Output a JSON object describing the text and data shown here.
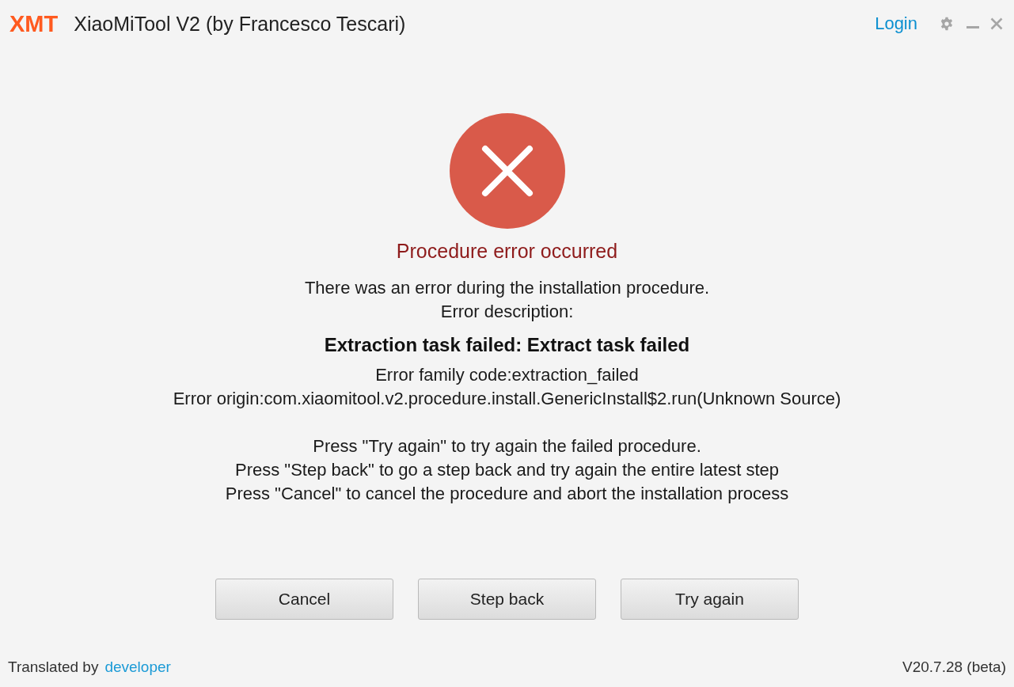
{
  "title_bar": {
    "logo": "XMT",
    "title": "XiaoMiTool V2 (by Francesco Tescari)",
    "login_link": "Login"
  },
  "error": {
    "heading": "Procedure error occurred",
    "intro_lines": [
      "There was an error during the installation procedure.",
      "Error description:"
    ],
    "summary": "Extraction task failed: Extract task failed",
    "detail_lines": [
      "Error family code:extraction_failed",
      "Error origin:com.xiaomitool.v2.procedure.install.GenericInstall$2.run(Unknown Source)"
    ],
    "instruction_lines": [
      "Press \"Try again\" to try again the failed procedure.",
      "Press \"Step back\" to go a step back and try again the entire latest step",
      "Press \"Cancel\" to cancel the procedure and abort the installation process"
    ]
  },
  "buttons": [
    {
      "label": "Cancel"
    },
    {
      "label": "Step back"
    },
    {
      "label": "Try again"
    }
  ],
  "footer": {
    "translated_by": "Translated by",
    "translator_link": "developer",
    "version": "V20.7.28 (beta)"
  }
}
